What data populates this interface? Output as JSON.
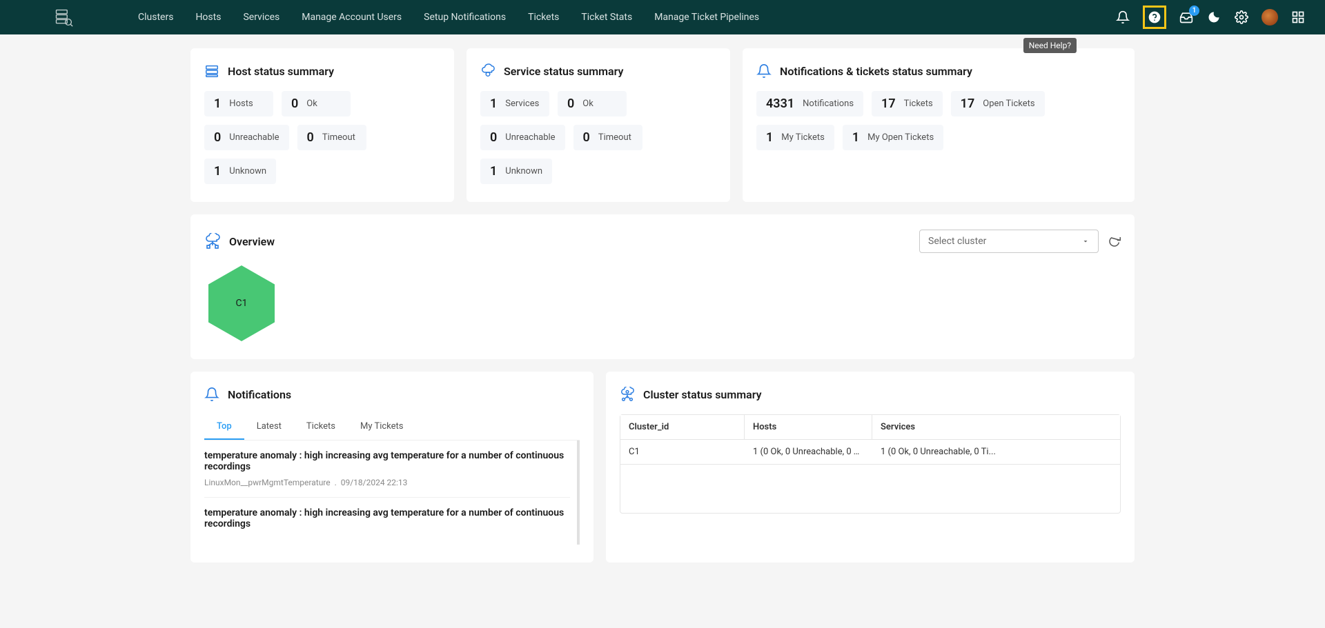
{
  "nav": {
    "links": [
      "Clusters",
      "Hosts",
      "Services",
      "Manage Account Users",
      "Setup Notifications",
      "Tickets",
      "Ticket Stats",
      "Manage Ticket Pipelines"
    ],
    "inbox_badge": "1",
    "tooltip": "Need Help?"
  },
  "host_summary": {
    "title": "Host status summary",
    "items": [
      {
        "v": "1",
        "l": "Hosts"
      },
      {
        "v": "0",
        "l": "Ok"
      },
      {
        "v": "0",
        "l": "Unreachable"
      },
      {
        "v": "0",
        "l": "Timeout"
      },
      {
        "v": "1",
        "l": "Unknown"
      }
    ]
  },
  "service_summary": {
    "title": "Service status summary",
    "items": [
      {
        "v": "1",
        "l": "Services"
      },
      {
        "v": "0",
        "l": "Ok"
      },
      {
        "v": "0",
        "l": "Unreachable"
      },
      {
        "v": "0",
        "l": "Timeout"
      },
      {
        "v": "1",
        "l": "Unknown"
      }
    ]
  },
  "notif_summary": {
    "title": "Notifications & tickets status summary",
    "items": [
      {
        "v": "4331",
        "l": "Notifications"
      },
      {
        "v": "17",
        "l": "Tickets"
      },
      {
        "v": "17",
        "l": "Open Tickets"
      },
      {
        "v": "1",
        "l": "My Tickets"
      },
      {
        "v": "1",
        "l": "My Open Tickets"
      }
    ]
  },
  "overview": {
    "title": "Overview",
    "select_placeholder": "Select cluster",
    "hex": "C1"
  },
  "notifications": {
    "title": "Notifications",
    "tabs": [
      "Top",
      "Latest",
      "Tickets",
      "My Tickets"
    ],
    "items": [
      {
        "title": "temperature anomaly : high increasing avg temperature for a number of continuous recordings",
        "source": "LinuxMon__pwrMgmtTemperature",
        "time": "09/18/2024 22:13"
      },
      {
        "title": "temperature anomaly : high increasing avg temperature for a number of continuous recordings",
        "source": "",
        "time": ""
      }
    ]
  },
  "cluster_status": {
    "title": "Cluster status summary",
    "headers": [
      "Cluster_id",
      "Hosts",
      "Services"
    ],
    "rows": [
      {
        "id": "C1",
        "hosts": "1 (0 Ok, 0 Unreachable, 0 Ti...",
        "services": "1 (0 Ok, 0 Unreachable, 0 Ti..."
      }
    ]
  }
}
